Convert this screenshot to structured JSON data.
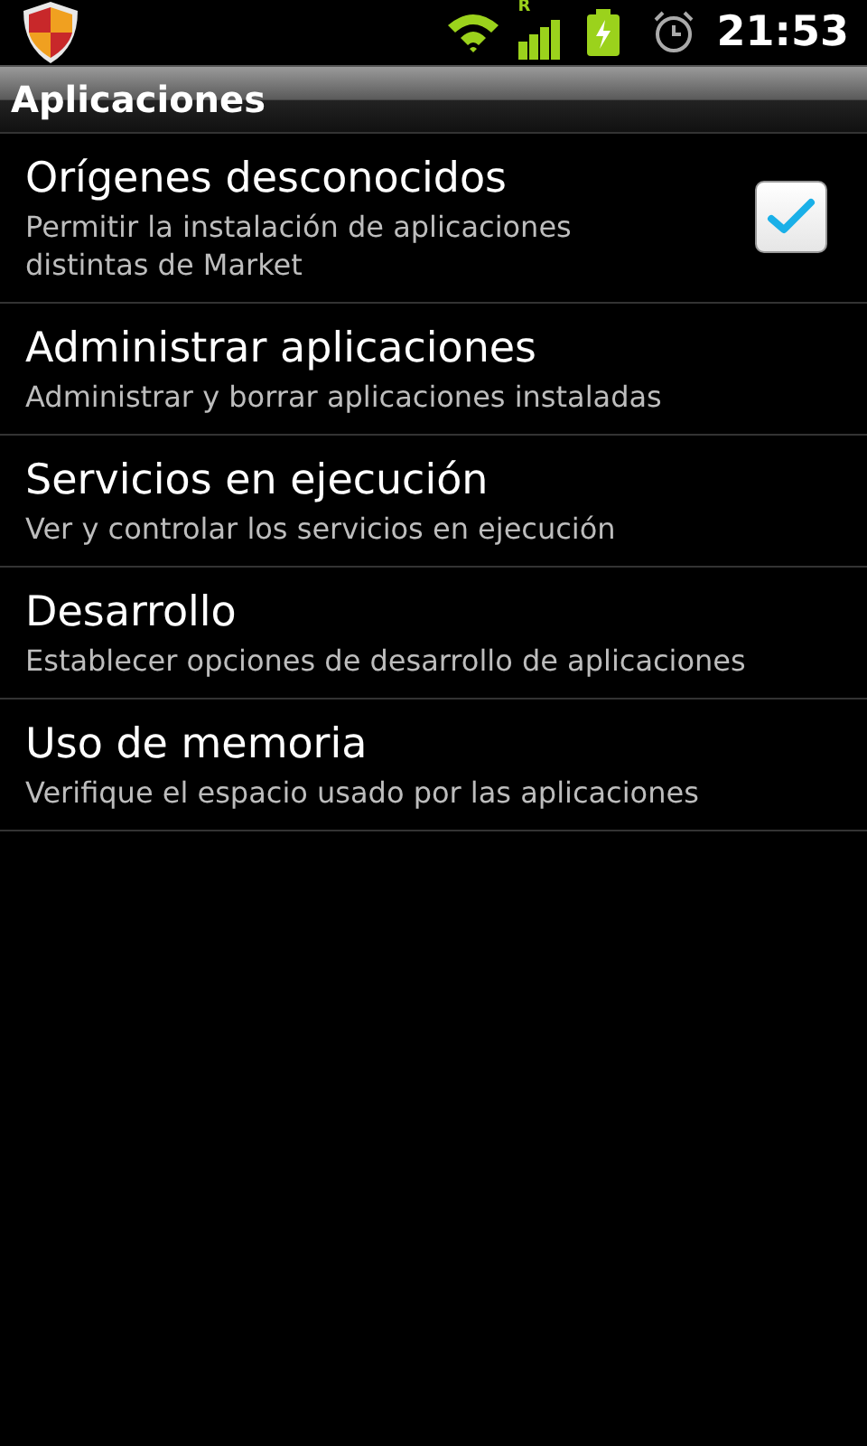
{
  "status_bar": {
    "roaming": "R",
    "time": "21:53"
  },
  "title": "Aplicaciones",
  "items": [
    {
      "kind": "checkbox",
      "title": "Orígenes desconocidos",
      "summary": "Permitir la instalación de aplicaciones distintas de Market",
      "checked": true
    },
    {
      "kind": "plain",
      "title": "Administrar aplicaciones",
      "summary": "Administrar y borrar aplicaciones instaladas"
    },
    {
      "kind": "plain",
      "title": "Servicios en ejecución",
      "summary": "Ver y controlar los servicios en ejecución"
    },
    {
      "kind": "plain",
      "title": "Desarrollo",
      "summary": "Establecer opciones de desarrollo de aplicaciones"
    },
    {
      "kind": "plain",
      "title": "Uso de memoria",
      "summary": "Verifique el espacio usado por las aplicaciones"
    }
  ]
}
